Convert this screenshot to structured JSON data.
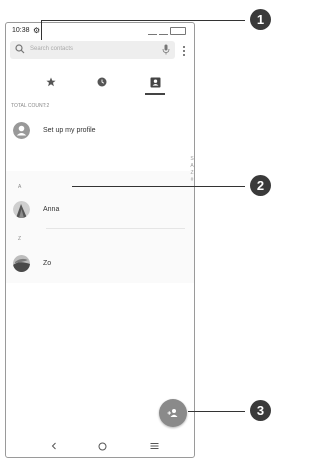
{
  "status": {
    "time": "10:38"
  },
  "search": {
    "placeholder": "Search contacts"
  },
  "tabs": [
    {
      "name": "favorites",
      "icon": "star-icon",
      "active": false
    },
    {
      "name": "recents",
      "icon": "clock-icon",
      "active": false
    },
    {
      "name": "contacts",
      "icon": "contacts-icon",
      "active": true
    }
  ],
  "list": {
    "total_count": "TOTAL COUNT:2",
    "profile_label": "Set up my profile",
    "sections": [
      {
        "letter": "A",
        "contacts": [
          {
            "name": "Anna"
          }
        ]
      },
      {
        "letter": "Z",
        "contacts": [
          {
            "name": "Zo"
          }
        ]
      }
    ],
    "index_letters": [
      "S",
      "A",
      "Z",
      "#"
    ]
  },
  "callouts": [
    "1",
    "2",
    "3"
  ],
  "colors": {
    "fab": "#8a8a8a",
    "callout": "#3a3a3a",
    "search_bg": "#eeeeee"
  }
}
